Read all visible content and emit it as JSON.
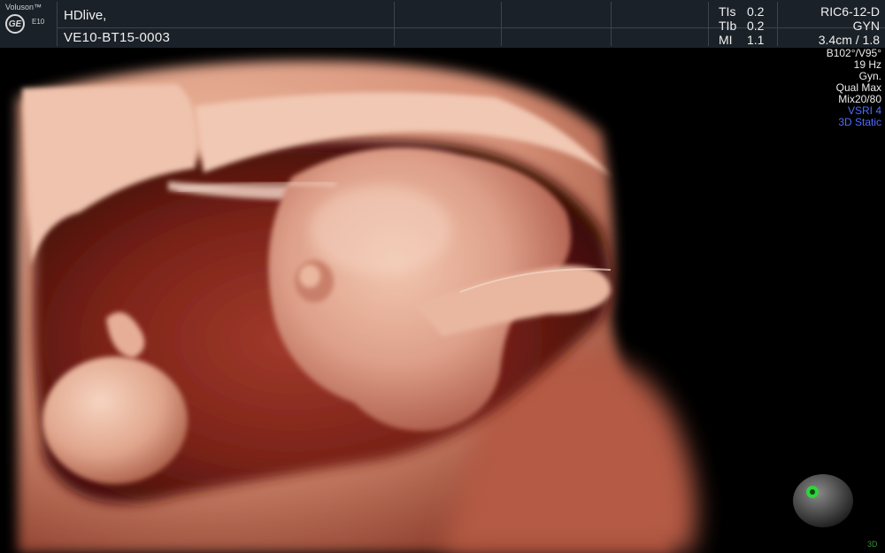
{
  "header": {
    "brand": "Voluson™",
    "model": "E10",
    "logo": "GE",
    "patient_name": "HDlive,",
    "patient_id": "VE10-BT15-0003",
    "indices": [
      {
        "label": "TIs",
        "value": "0.2"
      },
      {
        "label": "TIb",
        "value": "0.2"
      },
      {
        "label": "MI",
        "value": "1.1"
      }
    ],
    "probe": "RIC6-12-D",
    "app": "GYN",
    "depth": "3.4cm / 1.8"
  },
  "params": {
    "line1": "B102°/V95°",
    "line2": "19 Hz",
    "line3": "Gyn.",
    "line4": "Qual Max",
    "line5": "Mix20/80",
    "vsri": "VSRI 4",
    "mode": "3D Static"
  },
  "orientation": {
    "icon": "orientation-sphere-icon",
    "corner_label": "3D"
  },
  "colors": {
    "vsri": "#4d6dff",
    "marker": "#2fd43a"
  }
}
